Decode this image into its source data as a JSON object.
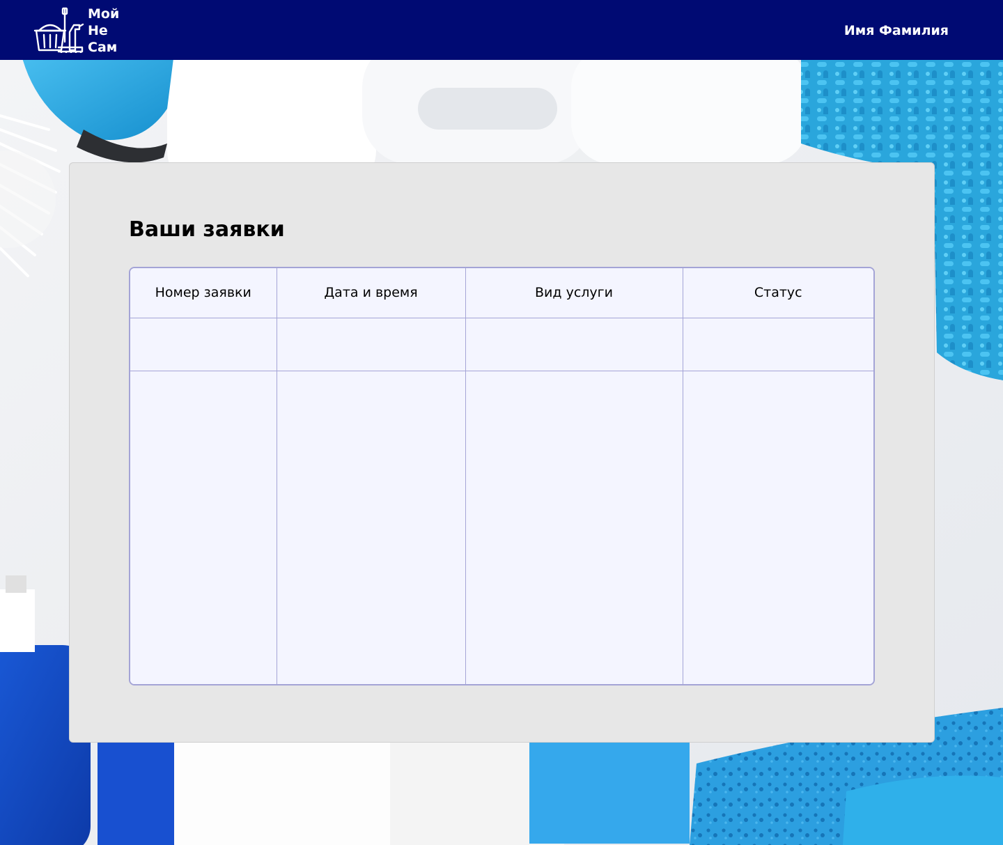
{
  "brand": {
    "logo_lines": [
      "Мой",
      "Не",
      "Сам"
    ],
    "logo_icon": "cleaning-bucket-mop-icon"
  },
  "header": {
    "user_name": "Имя Фамилия",
    "background_color": "#000a73"
  },
  "main": {
    "title": "Ваши заявки",
    "table": {
      "columns": [
        "Номер заявки",
        "Дата и время",
        "Вид услуги",
        "Статус"
      ],
      "rows": [
        [
          "",
          "",
          "",
          ""
        ],
        [
          "",
          "",
          "",
          ""
        ]
      ]
    }
  },
  "colors": {
    "card_bg": "#e7e7e7",
    "table_border": "#a4a4d6",
    "table_bg": "#f4f5ff",
    "accent_blue": "#2aa6dc"
  }
}
